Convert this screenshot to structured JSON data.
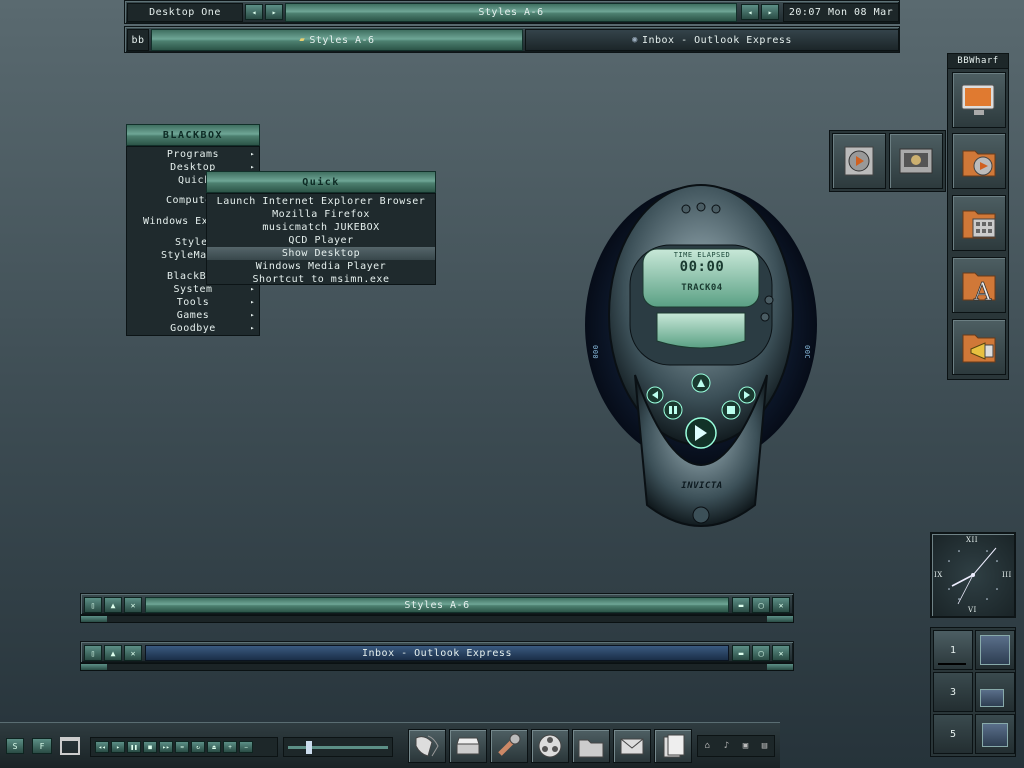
{
  "toolbar": {
    "workspace_label": "Desktop One",
    "title": "Styles A-6",
    "clock": "20:07 Mon 08 Mar",
    "ws_prev": "◂",
    "ws_next": "▸",
    "win_prev": "◂",
    "win_next": "▸"
  },
  "taskbar": {
    "bb_label": "bb",
    "tasks": [
      {
        "label": "Styles A-6"
      },
      {
        "label": "Inbox - Outlook Express"
      }
    ]
  },
  "menu": {
    "title": "BLACKBOX",
    "items": [
      {
        "label": "Programs",
        "submenu": true
      },
      {
        "label": "Desktop",
        "submenu": true
      },
      {
        "label": "Quick",
        "submenu": true
      },
      {
        "label": "Computer",
        "submenu": false
      },
      {
        "label": "Windows Ex",
        "submenu": false
      },
      {
        "label": "Styles",
        "submenu": true
      },
      {
        "label": "StyleMa",
        "submenu": true
      },
      {
        "label": "BlackB",
        "submenu": true
      },
      {
        "label": "System",
        "submenu": true
      },
      {
        "label": "Tools",
        "submenu": true
      },
      {
        "label": "Games",
        "submenu": true
      },
      {
        "label": "Goodbye",
        "submenu": true
      }
    ],
    "arrow": "▸"
  },
  "submenu": {
    "title": "Quick",
    "items": [
      {
        "label": "Launch Internet Explorer Browser"
      },
      {
        "label": "Mozilla Firefox"
      },
      {
        "label": "musicmatch JUKEBOX"
      },
      {
        "label": "QCD Player"
      },
      {
        "label": "Show Desktop"
      },
      {
        "label": "Windows Media Player"
      },
      {
        "label": "Shortcut to msimn.exe"
      }
    ]
  },
  "slit": {
    "label": "BBWharf"
  },
  "player": {
    "time_label": "TIME ELAPSED",
    "time": "00:00",
    "track": "TRACK04",
    "brand": "INVICTA",
    "side_left": "000",
    "side_right": "00C"
  },
  "windows": [
    {
      "title": "Styles A-6"
    },
    {
      "title": "Inbox - Outlook Express"
    }
  ],
  "clock_face": {
    "numerals": [
      "XII",
      "III",
      "VI",
      "IX"
    ]
  },
  "pager": {
    "desktops": [
      "1",
      "",
      "3",
      "",
      "5",
      ""
    ]
  },
  "bottombar": {
    "left_buttons": [
      "S",
      "F"
    ]
  },
  "colors": {
    "accent": "#6fa696",
    "background": "#4a5a60"
  }
}
